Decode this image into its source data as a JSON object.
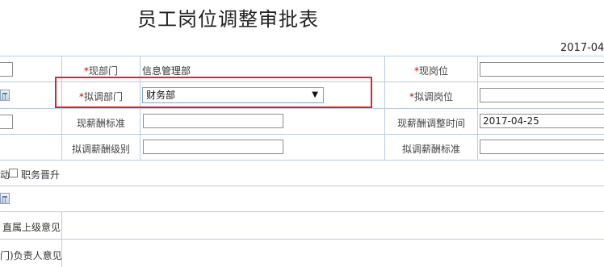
{
  "form": {
    "title": "员工岗位调整审批表",
    "date": "2017-04"
  },
  "rows": {
    "current_dept": {
      "label": "现部门",
      "required": "*",
      "value": "信息管理部"
    },
    "current_position": {
      "label": "现岗位",
      "required": "*"
    },
    "proposed_dept": {
      "label": "拟调部门",
      "required": "*",
      "selected": "财务部"
    },
    "proposed_position": {
      "label": "拟调岗位",
      "required": "*"
    },
    "current_salary_std": {
      "label": "现薪酬标准"
    },
    "salary_adjust_time": {
      "label": "现薪酬调整时间",
      "value": "2017-04-25"
    },
    "proposed_salary_level": {
      "label": "拟调薪酬级别"
    },
    "proposed_salary_std": {
      "label": "拟调薪酬标准"
    }
  },
  "options": {
    "partial_prefix": "动",
    "promotion_label": "职务晋升"
  },
  "opinions": {
    "supervisor": "直属上级意见",
    "dept_head": "门)负责人意见"
  }
}
